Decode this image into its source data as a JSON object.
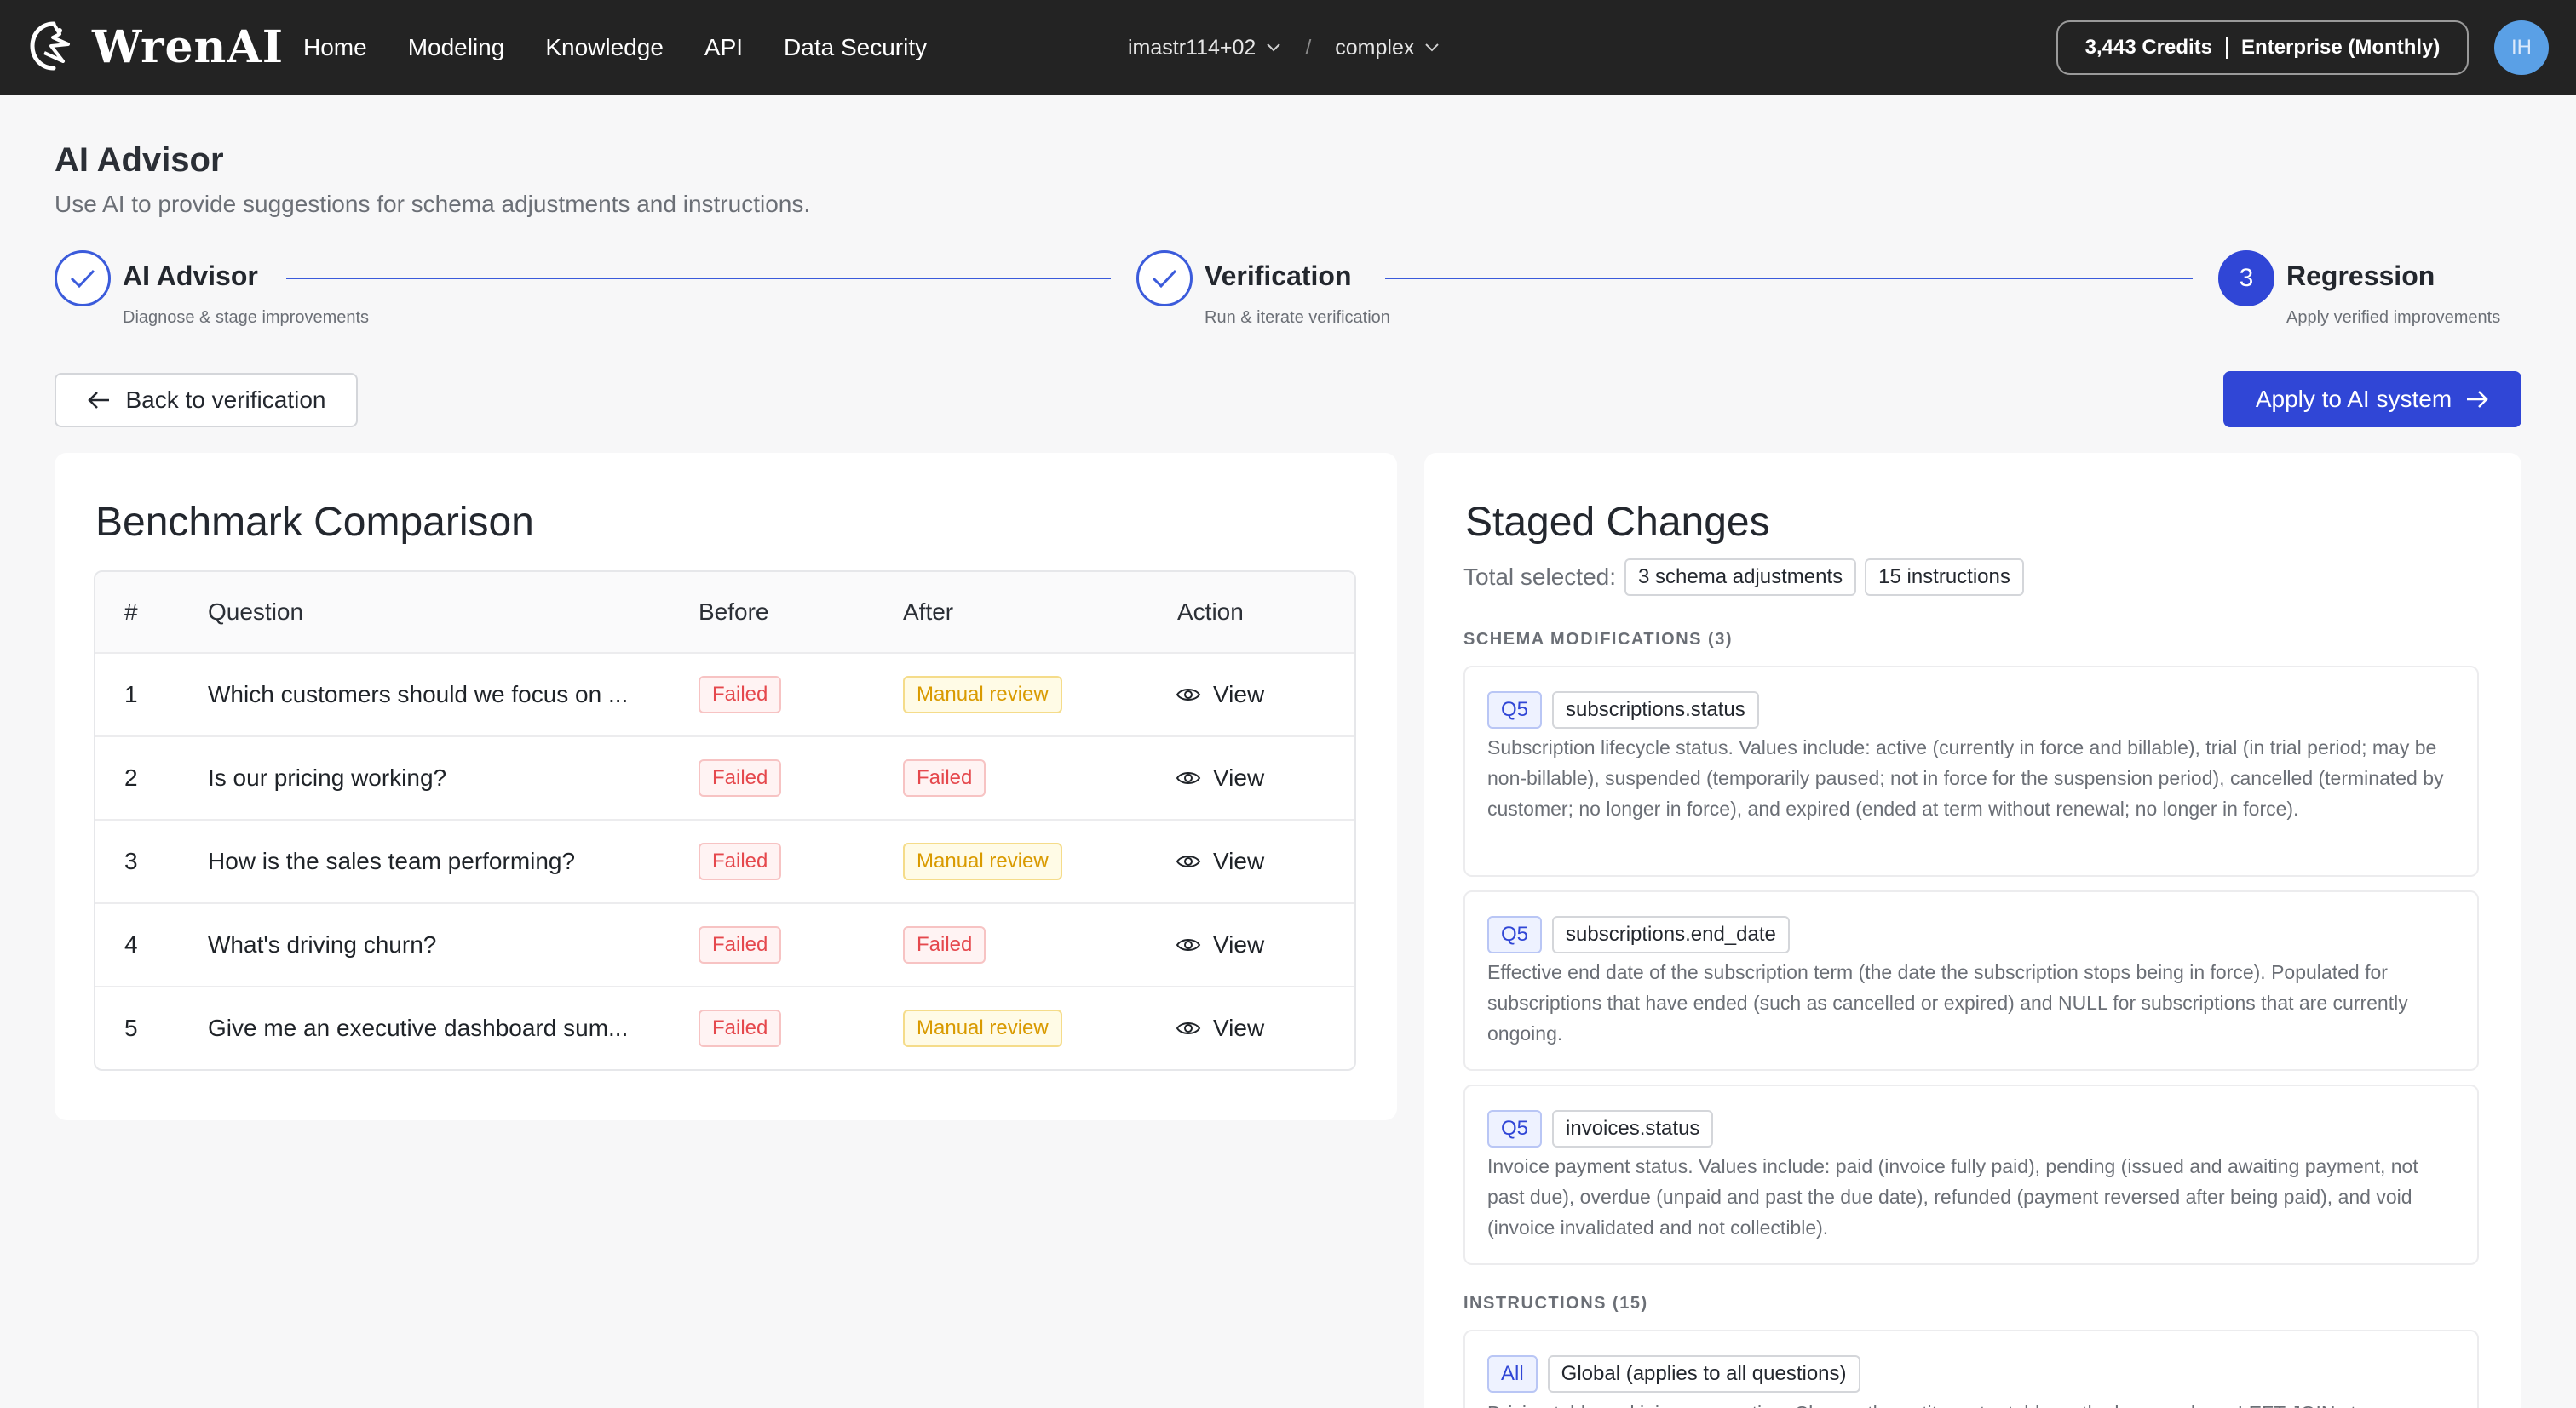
{
  "app": {
    "brand": "WrenAI",
    "nav": [
      "Home",
      "Modeling",
      "Knowledge",
      "API",
      "Data Security"
    ],
    "workspace": "imastr114+02",
    "project": "complex",
    "credits": "3,443 Credits",
    "plan": "Enterprise (Monthly)",
    "avatar_initials": "IH"
  },
  "page": {
    "title": "AI Advisor",
    "subtitle": "Use AI to provide suggestions for schema adjustments and instructions."
  },
  "steps": [
    {
      "title": "AI Advisor",
      "desc": "Diagnose & stage improvements",
      "state": "done"
    },
    {
      "title": "Verification",
      "desc": "Run & iterate verification",
      "state": "done"
    },
    {
      "title": "Regression",
      "desc": "Apply verified improvements",
      "state": "active",
      "number": "3"
    }
  ],
  "actions": {
    "back_label": "Back to verification",
    "apply_label": "Apply to AI system"
  },
  "benchmark": {
    "title": "Benchmark Comparison",
    "columns": [
      "#",
      "Question",
      "Before",
      "After",
      "Action"
    ],
    "rows": [
      {
        "num": "1",
        "question": "Which customers should we focus on ...",
        "before": "Failed",
        "after": "Manual review",
        "action": "View"
      },
      {
        "num": "2",
        "question": "Is our pricing working?",
        "before": "Failed",
        "after": "Failed",
        "action": "View"
      },
      {
        "num": "3",
        "question": "How is the sales team performing?",
        "before": "Failed",
        "after": "Manual review",
        "action": "View"
      },
      {
        "num": "4",
        "question": "What's driving churn?",
        "before": "Failed",
        "after": "Failed",
        "action": "View"
      },
      {
        "num": "5",
        "question": "Give me an executive dashboard sum...",
        "before": "Failed",
        "after": "Manual review",
        "action": "View"
      }
    ]
  },
  "staged": {
    "title": "Staged Changes",
    "total_label": "Total selected:",
    "schema_chip": "3 schema adjustments",
    "instr_chip": "15 instructions",
    "schema_section": "SCHEMA MODIFICATIONS (3)",
    "instructions_section": "INSTRUCTIONS (15)",
    "mods": [
      {
        "q": "Q5",
        "column": "subscriptions.status",
        "desc": "Subscription lifecycle status. Values include: active (currently in force and billable), trial (in trial period; may be non-billable), suspended (temporarily paused; not in force for the suspension period), cancelled (terminated by customer; no longer in force), and expired (ended at term without renewal; no longer in force)."
      },
      {
        "q": "Q5",
        "column": "subscriptions.end_date",
        "desc": "Effective end date of the subscription term (the date the subscription stops being in force). Populated for subscriptions that have ended (such as cancelled or expired) and NULL for subscriptions that are currently ongoing."
      },
      {
        "q": "Q5",
        "column": "invoices.status",
        "desc": "Invoice payment status. Values include: paid (invoice fully paid), pending (issued and awaiting payment, not past due), overdue (unpaid and past the due date), refunded (payment reversed after being paid), and void (invoice invalidated and not collectible)."
      }
    ],
    "instruction": {
      "scope": "All",
      "label": "Global (applies to all questions)",
      "desc": "Driving table and join preservation: Choose the entity roster table as the base and use LEFT JOINs to"
    }
  },
  "colors": {
    "accent": "#3046d6",
    "topbar": "#232323",
    "failed": "#e5484d",
    "manual": "#d99a00"
  },
  "icons": [
    "wrenai-logo-icon",
    "chevron-down-icon",
    "check-icon",
    "arrow-left-icon",
    "arrow-right-icon",
    "eye-icon"
  ]
}
